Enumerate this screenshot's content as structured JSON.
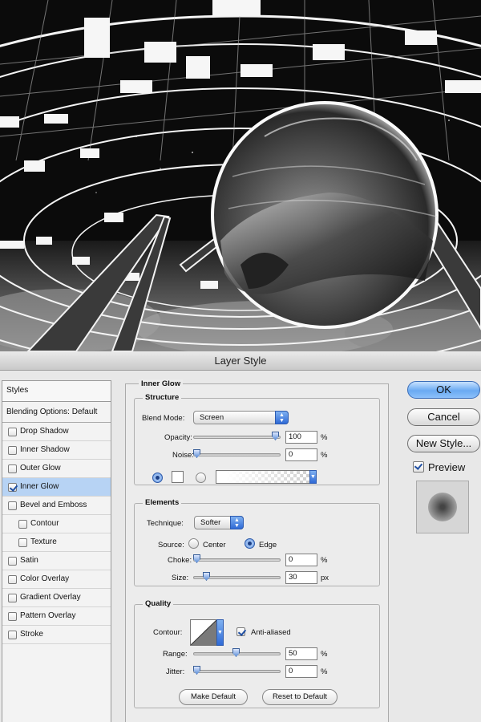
{
  "dialog": {
    "title": "Layer Style"
  },
  "styles_list": {
    "header": "Styles",
    "blending_options": "Blending Options: Default",
    "items": [
      {
        "label": "Drop Shadow",
        "checked": false,
        "sub": false,
        "selected": false
      },
      {
        "label": "Inner Shadow",
        "checked": false,
        "sub": false,
        "selected": false
      },
      {
        "label": "Outer Glow",
        "checked": false,
        "sub": false,
        "selected": false
      },
      {
        "label": "Inner Glow",
        "checked": true,
        "sub": false,
        "selected": true
      },
      {
        "label": "Bevel and Emboss",
        "checked": false,
        "sub": false,
        "selected": false
      },
      {
        "label": "Contour",
        "checked": false,
        "sub": true,
        "selected": false
      },
      {
        "label": "Texture",
        "checked": false,
        "sub": true,
        "selected": false
      },
      {
        "label": "Satin",
        "checked": false,
        "sub": false,
        "selected": false
      },
      {
        "label": "Color Overlay",
        "checked": false,
        "sub": false,
        "selected": false
      },
      {
        "label": "Gradient Overlay",
        "checked": false,
        "sub": false,
        "selected": false
      },
      {
        "label": "Pattern Overlay",
        "checked": false,
        "sub": false,
        "selected": false
      },
      {
        "label": "Stroke",
        "checked": false,
        "sub": false,
        "selected": false
      }
    ]
  },
  "panel": {
    "section_title": "Inner Glow",
    "structure": {
      "title": "Structure",
      "blend_mode_label": "Blend Mode:",
      "blend_mode_value": "Screen",
      "opacity_label": "Opacity:",
      "opacity_value": "100",
      "opacity_unit": "%",
      "opacity_level": 1.0,
      "noise_label": "Noise:",
      "noise_value": "0",
      "noise_unit": "%",
      "noise_level": 0.0,
      "color_mode": "solid"
    },
    "elements": {
      "title": "Elements",
      "technique_label": "Technique:",
      "technique_value": "Softer",
      "source_label": "Source:",
      "source_center": "Center",
      "source_edge": "Edge",
      "source_selected": "edge",
      "choke_label": "Choke:",
      "choke_value": "0",
      "choke_unit": "%",
      "choke_level": 0.0,
      "size_label": "Size:",
      "size_value": "30",
      "size_unit": "px",
      "size_level": 0.12
    },
    "quality": {
      "title": "Quality",
      "contour_label": "Contour:",
      "anti_aliased_label": "Anti-aliased",
      "anti_aliased": true,
      "range_label": "Range:",
      "range_value": "50",
      "range_unit": "%",
      "range_level": 0.5,
      "jitter_label": "Jitter:",
      "jitter_value": "0",
      "jitter_unit": "%",
      "jitter_level": 0.0
    },
    "make_default": "Make Default",
    "reset_to_default": "Reset to Default"
  },
  "actions": {
    "ok": "OK",
    "cancel": "Cancel",
    "new_style": "New Style...",
    "preview_label": "Preview",
    "preview_checked": true
  },
  "colors": {
    "accent": "#6aaaf2",
    "selection": "#b7d3f4"
  }
}
